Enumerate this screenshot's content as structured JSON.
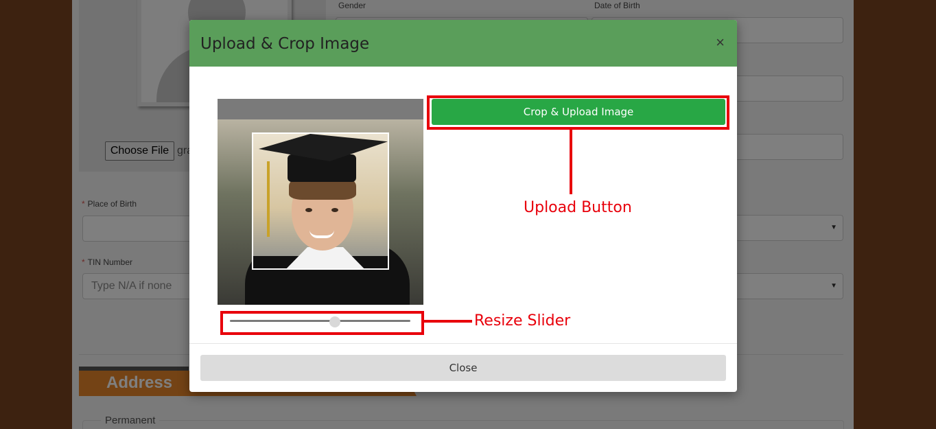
{
  "background_form": {
    "choose_file_label": "Choose File",
    "file_name": "grad",
    "gender_label": "Gender",
    "dob_label": "Date of Birth",
    "place_of_birth_label": "Place of Birth",
    "tin_label": "TIN Number",
    "tin_placeholder": "Type N/A if none",
    "required_mark": "*",
    "address_heading": "Address",
    "permanent_legend": "Permanent"
  },
  "modal": {
    "title": "Upload & Crop Image",
    "close_x": "×",
    "crop_upload_label": "Crop & Upload Image",
    "close_label": "Close",
    "slider_value": 0.58
  },
  "annotations": {
    "upload_button_label": "Upload Button",
    "resize_slider_label": "Resize Slider",
    "color": "#e8000b"
  },
  "colors": {
    "header_green": "#5a9e5a",
    "button_green": "#28a745",
    "address_orange": "#e8872a",
    "side_brown": "#7b4521"
  }
}
